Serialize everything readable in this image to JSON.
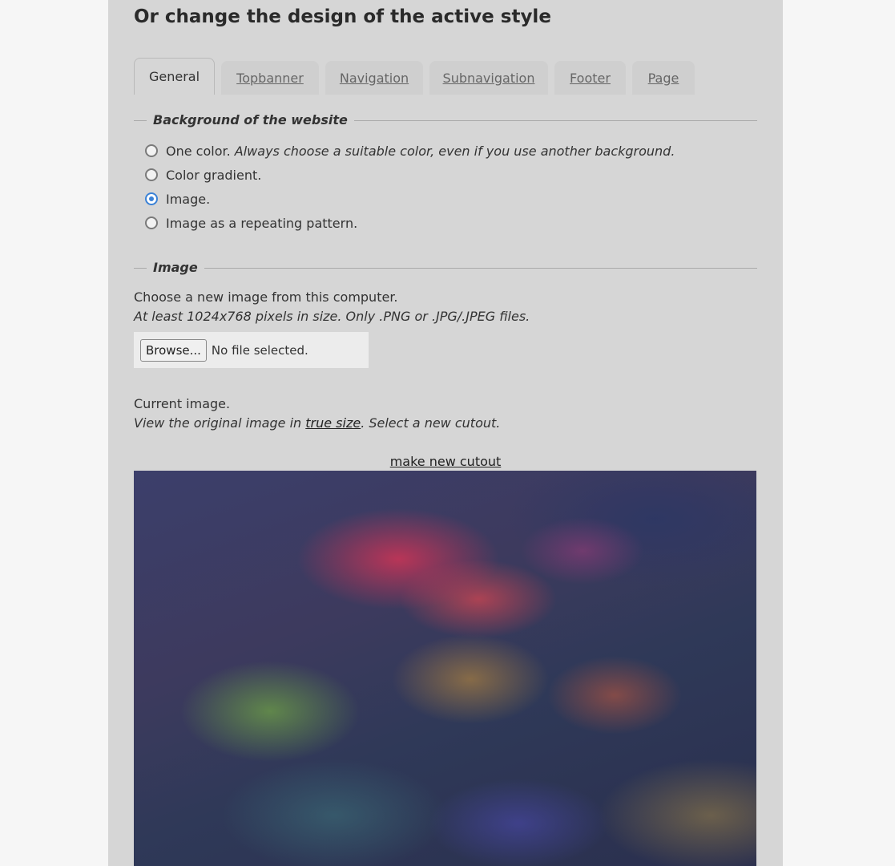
{
  "page": {
    "heading": "Or change the design of the active style"
  },
  "tabs": [
    {
      "label": "General",
      "active": true
    },
    {
      "label": "Topbanner",
      "active": false
    },
    {
      "label": "Navigation",
      "active": false
    },
    {
      "label": "Subnavigation",
      "active": false
    },
    {
      "label": "Footer",
      "active": false
    },
    {
      "label": "Page",
      "active": false
    }
  ],
  "background_section": {
    "legend": "Background of the website",
    "options": [
      {
        "label": "One color.",
        "note": "Always choose a suitable color, even if you use another background.",
        "checked": false
      },
      {
        "label": "Color gradient.",
        "note": "",
        "checked": false
      },
      {
        "label": "Image.",
        "note": "",
        "checked": true
      },
      {
        "label": "Image as a repeating pattern.",
        "note": "",
        "checked": false
      }
    ]
  },
  "image_section": {
    "legend": "Image",
    "choose_text": "Choose a new image from this computer.",
    "requirements": "At least 1024x768 pixels in size. Only .PNG or .JPG/.JPEG files.",
    "browse_label": "Browse...",
    "file_status": "No file selected.",
    "current_image": "Current image.",
    "view_prefix": "View the original image in ",
    "view_link": "true size",
    "view_suffix": ". Select a new cutout.",
    "cutout_link": "make new cutout"
  },
  "colors": {
    "panel_bg": "#d6d6d6",
    "page_bg": "#f6f6f6",
    "radio_checked": "#3b82d6"
  }
}
